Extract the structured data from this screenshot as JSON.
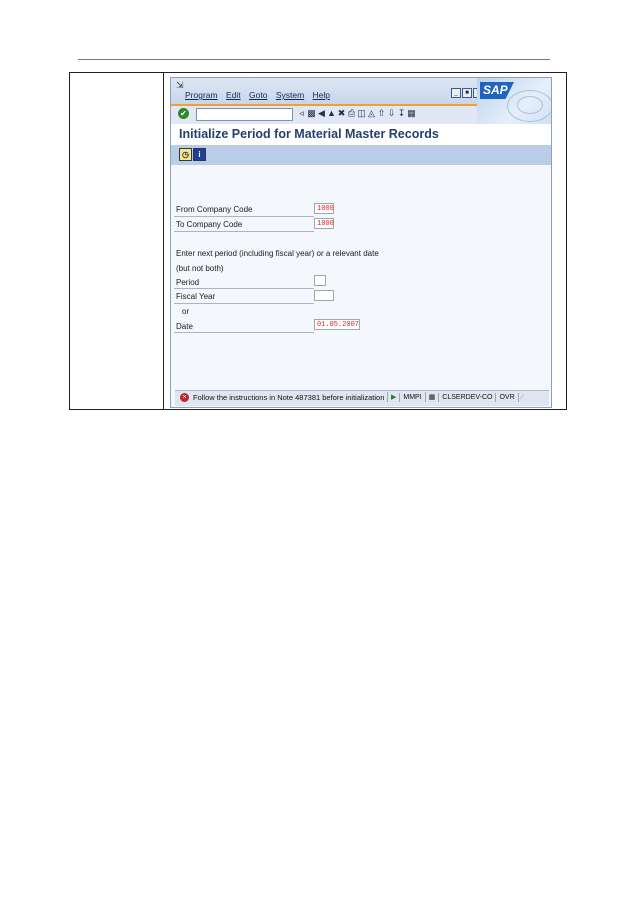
{
  "menu": {
    "items": [
      "Program",
      "Edit",
      "Goto",
      "System",
      "Help"
    ]
  },
  "logo": {
    "text": "SAP"
  },
  "screen": {
    "title": "Initialize Period for Material Master Records"
  },
  "form": {
    "from_company_label": "From Company Code",
    "from_company_value": "1000",
    "to_company_label": "To Company Code",
    "to_company_value": "1000",
    "instruction_1": "Enter next period (including fiscal year) or a relevant date",
    "instruction_2": "(but not both)",
    "period_label": "Period",
    "period_value": "",
    "fiscal_year_label": "Fiscal Year",
    "fiscal_year_value": "",
    "or_label": "or",
    "date_label": "Date",
    "date_value": "01.05.2007"
  },
  "status": {
    "message": "Follow the instructions in Note 487381 before initialization",
    "transaction": "MMPI",
    "server": "CLSERDEV-CO",
    "mode": "OVR"
  }
}
